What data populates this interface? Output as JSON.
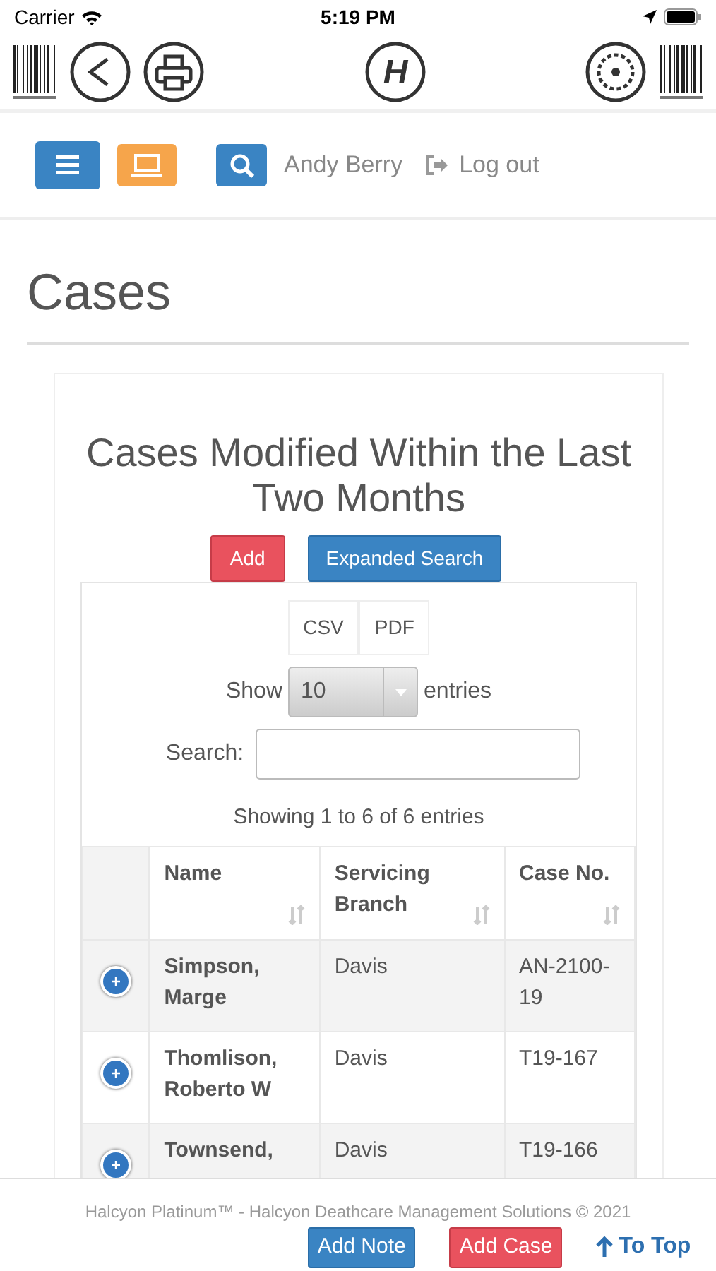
{
  "status_bar": {
    "carrier": "Carrier",
    "time": "5:19 PM"
  },
  "toolbar": {
    "logo": "H"
  },
  "nav": {
    "user": "Andy Berry",
    "logout": "Log out"
  },
  "page_title": "Cases",
  "panel": {
    "title": "Cases Modified Within the Last Two Months",
    "buttons": [
      {
        "label": "Add",
        "kind": "danger"
      },
      {
        "label": "Expanded Search",
        "kind": "primary"
      }
    ],
    "export_buttons": [
      "CSV",
      "PDF"
    ],
    "length": {
      "prefix": "Show",
      "value": "10",
      "suffix": "entries"
    },
    "search": {
      "label": "Search:"
    },
    "info": "Showing 1 to 6 of 6 entries",
    "table": {
      "columns": [
        "Name",
        "Servicing Branch",
        "Case No."
      ],
      "rows": [
        {
          "cells": [
            "Simpson, Marge",
            "Davis",
            "AN-2100-19"
          ]
        },
        {
          "cells": [
            "Thomlison, Roberto W",
            "Davis",
            "T19-167"
          ]
        },
        {
          "cells": [
            "Townsend,",
            "Davis",
            "T19-166"
          ]
        }
      ]
    }
  },
  "footer": {
    "copyright": "Halcyon Platinum™ - Halcyon Deathcare Management Solutions © 2021",
    "buttons": [
      {
        "label": "Add Note",
        "kind": "primary"
      },
      {
        "label": "Add Case",
        "kind": "danger"
      }
    ],
    "to_top": "To Top"
  }
}
